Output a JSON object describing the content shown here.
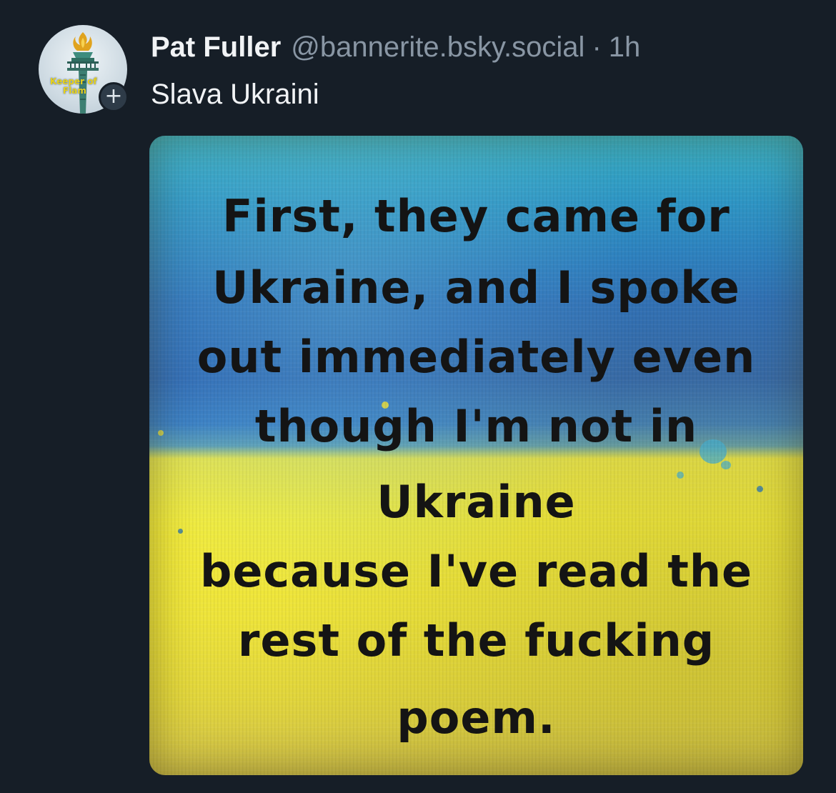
{
  "post": {
    "author_name": "Pat Fuller",
    "author_handle": "@bannerite.bsky.social",
    "separator": "·",
    "timestamp": "1h",
    "text": "Slava Ukraini",
    "avatar": {
      "icon": "statue-of-liberty-torch",
      "caption_line1": "Keeper of",
      "caption_line2": "Flam"
    },
    "follow_icon": "+",
    "image": {
      "background_colors": {
        "top": "#2c6fba",
        "bottom": "#f3ec3c"
      },
      "lines": [
        "First, they came for",
        "Ukraine, and I spoke",
        "out immediately even",
        "though I'm not in",
        "Ukraine",
        "because I've read the",
        "rest of the fucking",
        "poem."
      ]
    }
  },
  "colors": {
    "background": "#161e27",
    "name_text": "#f1f3f5",
    "muted_text": "#8996a4",
    "accent_avatar_text": "#e9d21a"
  }
}
